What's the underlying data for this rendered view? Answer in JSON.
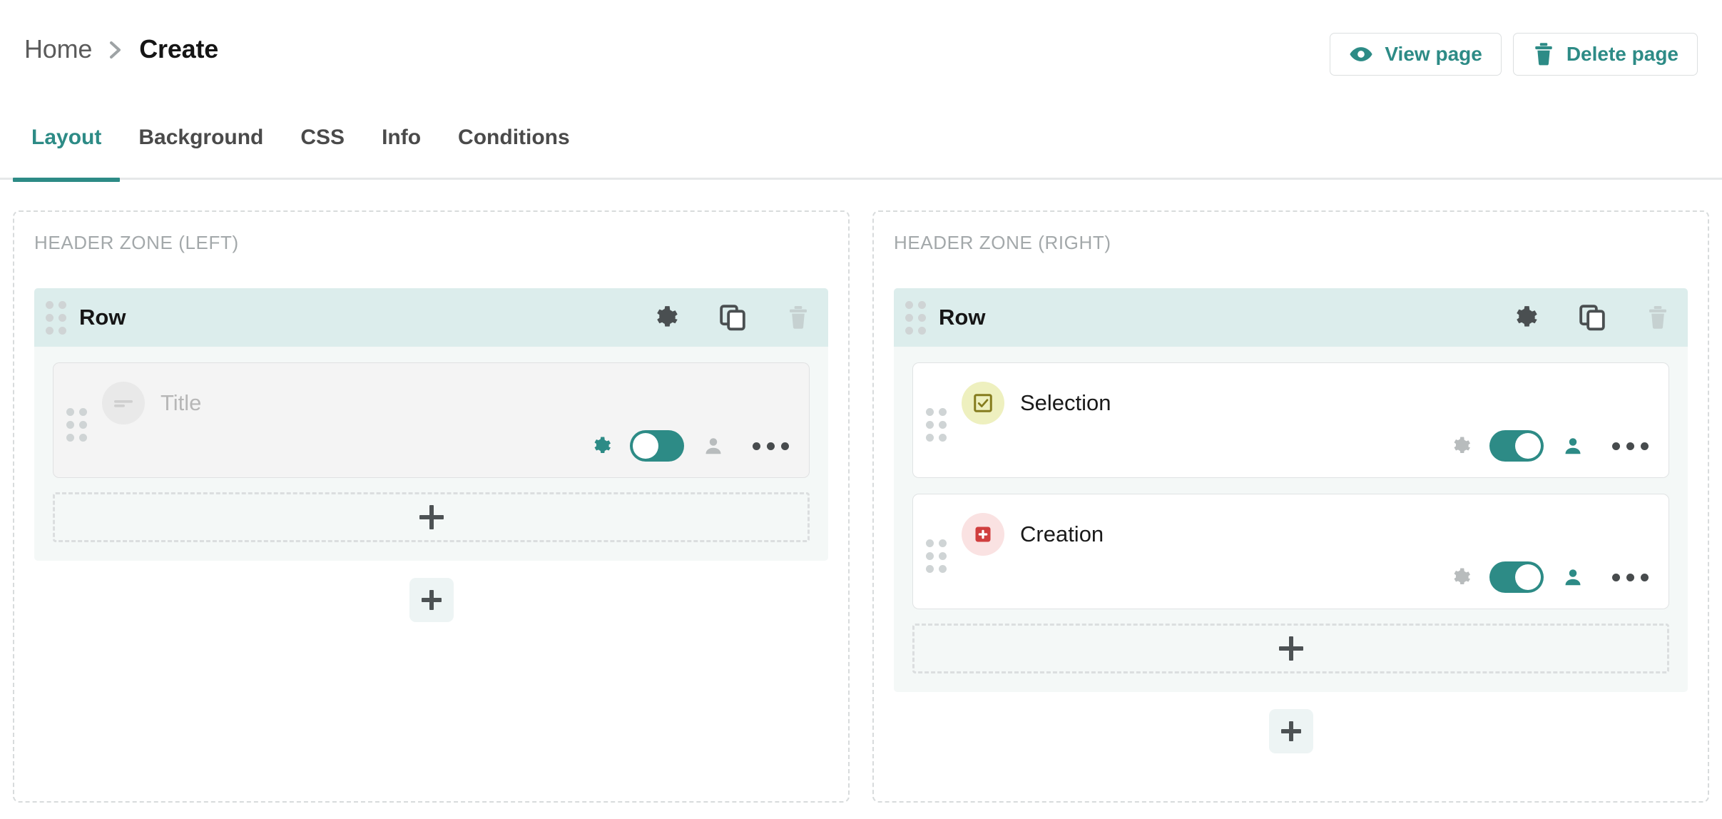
{
  "breadcrumb": {
    "home": "Home",
    "separator_icon": "chevron-right-icon",
    "current": "Create"
  },
  "topbar": {
    "view_page_label": "View page",
    "view_page_icon": "eye-icon",
    "delete_page_label": "Delete page",
    "delete_page_icon": "trash-icon"
  },
  "tabs": [
    {
      "label": "Layout",
      "active": true
    },
    {
      "label": "Background",
      "active": false
    },
    {
      "label": "CSS",
      "active": false
    },
    {
      "label": "Info",
      "active": false
    },
    {
      "label": "Conditions",
      "active": false
    }
  ],
  "colors": {
    "accent": "#2d8b86",
    "row_header_bg": "#dcedec",
    "row_body_bg": "#f4f8f7",
    "zone_border": "#d8dbdc",
    "selection_icon": "#857c1e",
    "selection_bg": "#eef0bf",
    "creation_icon": "#d03e3e",
    "creation_bg": "#fae2e2",
    "muted_text": "#b7b7b7"
  },
  "zones": [
    {
      "label": "HEADER ZONE (LEFT)",
      "row": {
        "title": "Row",
        "header_icons": [
          "gear-icon",
          "copy-icon",
          "trash-icon"
        ],
        "trash_disabled": true,
        "widgets": [
          {
            "label": "Title",
            "icon": "text-lines-icon",
            "muted": true,
            "gear_active": true,
            "toggle_on": false,
            "person_active": false
          }
        ],
        "add_slot_icon": "plus-icon"
      },
      "add_row_icon": "plus-icon"
    },
    {
      "label": "HEADER ZONE (RIGHT)",
      "row": {
        "title": "Row",
        "header_icons": [
          "gear-icon",
          "copy-icon",
          "trash-icon"
        ],
        "trash_disabled": true,
        "widgets": [
          {
            "label": "Selection",
            "icon": "checkbox-checked-icon",
            "muted": false,
            "gear_active": false,
            "toggle_on": true,
            "person_active": true
          },
          {
            "label": "Creation",
            "icon": "plus-square-icon",
            "muted": false,
            "gear_active": false,
            "toggle_on": true,
            "person_active": true
          }
        ],
        "add_slot_icon": "plus-icon"
      },
      "add_row_icon": "plus-icon"
    }
  ]
}
